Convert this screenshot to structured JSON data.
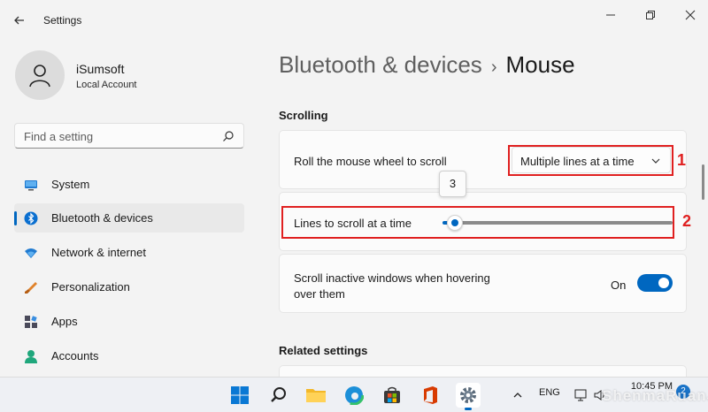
{
  "window": {
    "title": "Settings"
  },
  "user": {
    "name": "iSumsoft",
    "account_type": "Local Account"
  },
  "search": {
    "placeholder": "Find a setting"
  },
  "nav": {
    "items": [
      {
        "label": "System",
        "icon": "monitor-icon",
        "active": false
      },
      {
        "label": "Bluetooth & devices",
        "icon": "bluetooth-icon",
        "active": true
      },
      {
        "label": "Network & internet",
        "icon": "wifi-icon",
        "active": false
      },
      {
        "label": "Personalization",
        "icon": "brush-icon",
        "active": false
      },
      {
        "label": "Apps",
        "icon": "apps-icon",
        "active": false
      },
      {
        "label": "Accounts",
        "icon": "person-icon",
        "active": false
      }
    ]
  },
  "breadcrumb": {
    "parent": "Bluetooth & devices",
    "separator": "›",
    "current": "Mouse"
  },
  "scrolling": {
    "section_title": "Scrolling",
    "wheel_label": "Roll the mouse wheel to scroll",
    "wheel_value": "Multiple lines at a time",
    "lines_label": "Lines to scroll at a time",
    "lines_value": "3",
    "lines_fraction": 0.03,
    "inactive_label_line1": "Scroll inactive windows when hovering",
    "inactive_label_line2": "over them",
    "inactive_state": "On",
    "inactive_on": true
  },
  "annotations": {
    "marker_1": "1",
    "marker_2": "2",
    "color": "#e02020"
  },
  "related": {
    "section_title": "Related settings"
  },
  "taskbar": {
    "language": "ENG",
    "time": "10:45 PM",
    "badge": "2"
  },
  "colors": {
    "accent": "#0067c0",
    "background": "#f3f3f3",
    "card": "#fbfbfb"
  }
}
